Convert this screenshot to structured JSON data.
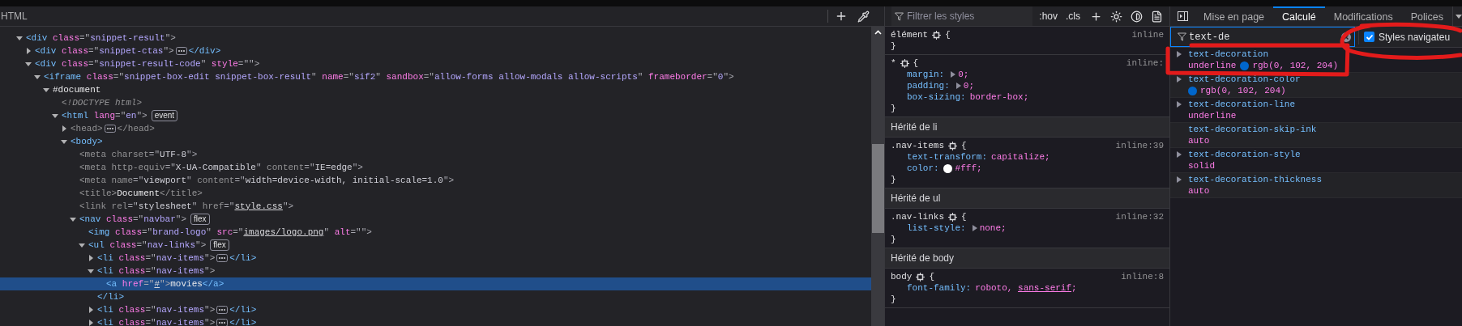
{
  "html_panel": {
    "title": "HTML",
    "tree": [
      {
        "expanded": true,
        "dimmed": false,
        "selected": false,
        "parts": [
          {
            "kind": "tag",
            "text": "<div"
          },
          {
            "kind": "attr",
            "text": " class"
          },
          {
            "kind": "punct",
            "text": "=\""
          },
          {
            "kind": "value",
            "text": "snippet-result"
          },
          {
            "kind": "punct",
            "text": "\">"
          }
        ],
        "children": [
          {
            "expanded": false,
            "dimmed": false,
            "selected": false,
            "parts": [
              {
                "kind": "tag",
                "text": "<div"
              },
              {
                "kind": "attr",
                "text": " class"
              },
              {
                "kind": "punct",
                "text": "=\""
              },
              {
                "kind": "value",
                "text": "snippet-ctas"
              },
              {
                "kind": "punct",
                "text": "\">"
              }
            ],
            "tail": [
              {
                "kind": "tag",
                "text": "</div>"
              }
            ]
          },
          {
            "expanded": true,
            "dimmed": false,
            "selected": false,
            "parts": [
              {
                "kind": "tag",
                "text": "<div"
              },
              {
                "kind": "attr",
                "text": " class"
              },
              {
                "kind": "punct",
                "text": "=\""
              },
              {
                "kind": "value",
                "text": "snippet-result-code"
              },
              {
                "kind": "punct",
                "text": "\""
              },
              {
                "kind": "attr",
                "text": " style"
              },
              {
                "kind": "punct",
                "text": "=\"\">"
              }
            ],
            "children": [
              {
                "expanded": true,
                "dimmed": false,
                "selected": false,
                "parts": [
                  {
                    "kind": "tag",
                    "text": "<iframe"
                  },
                  {
                    "kind": "attr",
                    "text": " class"
                  },
                  {
                    "kind": "punct",
                    "text": "=\""
                  },
                  {
                    "kind": "value",
                    "text": "snippet-box-edit snippet-box-result"
                  },
                  {
                    "kind": "punct",
                    "text": "\""
                  },
                  {
                    "kind": "attr",
                    "text": " name"
                  },
                  {
                    "kind": "punct",
                    "text": "=\""
                  },
                  {
                    "kind": "value",
                    "text": "sif2"
                  },
                  {
                    "kind": "punct",
                    "text": "\""
                  },
                  {
                    "kind": "attr",
                    "text": " sandbox"
                  },
                  {
                    "kind": "punct",
                    "text": "=\""
                  },
                  {
                    "kind": "value",
                    "text": "allow-forms allow-modals allow-scripts"
                  },
                  {
                    "kind": "punct",
                    "text": "\""
                  },
                  {
                    "kind": "attr",
                    "text": " frameborder"
                  },
                  {
                    "kind": "punct",
                    "text": "=\""
                  },
                  {
                    "kind": "value",
                    "text": "0"
                  },
                  {
                    "kind": "punct",
                    "text": "\">"
                  }
                ],
                "children": [
                  {
                    "expanded": true,
                    "dimmed": false,
                    "selected": false,
                    "parts": [
                      {
                        "kind": "text",
                        "text": "#document"
                      }
                    ],
                    "children": [
                      {
                        "dimmed": true,
                        "selected": false,
                        "parts": [
                          {
                            "kind": "doctype",
                            "text": "<!DOCTYPE html>"
                          }
                        ]
                      },
                      {
                        "expanded": true,
                        "dimmed": false,
                        "selected": false,
                        "parts": [
                          {
                            "kind": "tag",
                            "text": "<html"
                          },
                          {
                            "kind": "attr",
                            "text": " lang"
                          },
                          {
                            "kind": "punct",
                            "text": "=\""
                          },
                          {
                            "kind": "value",
                            "text": "en"
                          },
                          {
                            "kind": "punct",
                            "text": "\">"
                          }
                        ],
                        "badge": "event",
                        "children": [
                          {
                            "expanded": false,
                            "dimmed": true,
                            "selected": false,
                            "parts": [
                              {
                                "kind": "tag",
                                "text": "<head>"
                              }
                            ],
                            "tail": [
                              {
                                "kind": "tag",
                                "text": "</head>"
                              }
                            ]
                          },
                          {
                            "expanded": true,
                            "dimmed": false,
                            "selected": false,
                            "parts": [
                              {
                                "kind": "tag",
                                "text": "<body>"
                              }
                            ],
                            "children": [
                              {
                                "dimmed": true,
                                "selected": false,
                                "parts": [
                                  {
                                    "kind": "tag",
                                    "text": "<meta"
                                  },
                                  {
                                    "kind": "attr",
                                    "text": " charset"
                                  },
                                  {
                                    "kind": "punct",
                                    "text": "=\""
                                  },
                                  {
                                    "kind": "value",
                                    "text": "UTF-8"
                                  },
                                  {
                                    "kind": "punct",
                                    "text": "\">"
                                  }
                                ]
                              },
                              {
                                "dimmed": true,
                                "selected": false,
                                "parts": [
                                  {
                                    "kind": "tag",
                                    "text": "<meta"
                                  },
                                  {
                                    "kind": "attr",
                                    "text": " http-equiv"
                                  },
                                  {
                                    "kind": "punct",
                                    "text": "=\""
                                  },
                                  {
                                    "kind": "value",
                                    "text": "X-UA-Compatible"
                                  },
                                  {
                                    "kind": "punct",
                                    "text": "\""
                                  },
                                  {
                                    "kind": "attr",
                                    "text": " content"
                                  },
                                  {
                                    "kind": "punct",
                                    "text": "=\""
                                  },
                                  {
                                    "kind": "value",
                                    "text": "IE=edge"
                                  },
                                  {
                                    "kind": "punct",
                                    "text": "\">"
                                  }
                                ]
                              },
                              {
                                "dimmed": true,
                                "selected": false,
                                "parts": [
                                  {
                                    "kind": "tag",
                                    "text": "<meta"
                                  },
                                  {
                                    "kind": "attr",
                                    "text": " name"
                                  },
                                  {
                                    "kind": "punct",
                                    "text": "=\""
                                  },
                                  {
                                    "kind": "value",
                                    "text": "viewport"
                                  },
                                  {
                                    "kind": "punct",
                                    "text": "\""
                                  },
                                  {
                                    "kind": "attr",
                                    "text": " content"
                                  },
                                  {
                                    "kind": "punct",
                                    "text": "=\""
                                  },
                                  {
                                    "kind": "value",
                                    "text": "width=device-width, initial-scale=1.0"
                                  },
                                  {
                                    "kind": "punct",
                                    "text": "\">"
                                  }
                                ]
                              },
                              {
                                "dimmed": true,
                                "selected": false,
                                "parts": [
                                  {
                                    "kind": "tag",
                                    "text": "<title>"
                                  },
                                  {
                                    "kind": "text",
                                    "text": "Document"
                                  },
                                  {
                                    "kind": "tag",
                                    "text": "</title>"
                                  }
                                ]
                              },
                              {
                                "dimmed": true,
                                "selected": false,
                                "parts": [
                                  {
                                    "kind": "tag",
                                    "text": "<link"
                                  },
                                  {
                                    "kind": "attr",
                                    "text": " rel"
                                  },
                                  {
                                    "kind": "punct",
                                    "text": "=\""
                                  },
                                  {
                                    "kind": "value",
                                    "text": "stylesheet"
                                  },
                                  {
                                    "kind": "punct",
                                    "text": "\""
                                  },
                                  {
                                    "kind": "attr",
                                    "text": " href"
                                  },
                                  {
                                    "kind": "punct",
                                    "text": "=\""
                                  },
                                  {
                                    "kind": "link",
                                    "text": "style.css"
                                  },
                                  {
                                    "kind": "punct",
                                    "text": "\">"
                                  }
                                ]
                              },
                              {
                                "expanded": true,
                                "dimmed": false,
                                "selected": false,
                                "parts": [
                                  {
                                    "kind": "tag",
                                    "text": "<nav"
                                  },
                                  {
                                    "kind": "attr",
                                    "text": " class"
                                  },
                                  {
                                    "kind": "punct",
                                    "text": "=\""
                                  },
                                  {
                                    "kind": "value",
                                    "text": "navbar"
                                  },
                                  {
                                    "kind": "punct",
                                    "text": "\">"
                                  }
                                ],
                                "badge": "flex",
                                "children": [
                                  {
                                    "dimmed": false,
                                    "selected": false,
                                    "parts": [
                                      {
                                        "kind": "tag",
                                        "text": "<img"
                                      },
                                      {
                                        "kind": "attr",
                                        "text": " class"
                                      },
                                      {
                                        "kind": "punct",
                                        "text": "=\""
                                      },
                                      {
                                        "kind": "value",
                                        "text": "brand-logo"
                                      },
                                      {
                                        "kind": "punct",
                                        "text": "\""
                                      },
                                      {
                                        "kind": "attr",
                                        "text": " src"
                                      },
                                      {
                                        "kind": "punct",
                                        "text": "=\""
                                      },
                                      {
                                        "kind": "link",
                                        "text": "images/logo.png"
                                      },
                                      {
                                        "kind": "punct",
                                        "text": "\""
                                      },
                                      {
                                        "kind": "attr",
                                        "text": " alt"
                                      },
                                      {
                                        "kind": "punct",
                                        "text": "=\"\">"
                                      }
                                    ]
                                  },
                                  {
                                    "expanded": true,
                                    "dimmed": false,
                                    "selected": false,
                                    "parts": [
                                      {
                                        "kind": "tag",
                                        "text": "<ul"
                                      },
                                      {
                                        "kind": "attr",
                                        "text": " class"
                                      },
                                      {
                                        "kind": "punct",
                                        "text": "=\""
                                      },
                                      {
                                        "kind": "value",
                                        "text": "nav-links"
                                      },
                                      {
                                        "kind": "punct",
                                        "text": "\">"
                                      }
                                    ],
                                    "badge": "flex",
                                    "children": [
                                      {
                                        "expanded": false,
                                        "dimmed": false,
                                        "selected": false,
                                        "parts": [
                                          {
                                            "kind": "tag",
                                            "text": "<li"
                                          },
                                          {
                                            "kind": "attr",
                                            "text": " class"
                                          },
                                          {
                                            "kind": "punct",
                                            "text": "=\""
                                          },
                                          {
                                            "kind": "value",
                                            "text": "nav-items"
                                          },
                                          {
                                            "kind": "punct",
                                            "text": "\">"
                                          }
                                        ],
                                        "tail": [
                                          {
                                            "kind": "tag",
                                            "text": "</li>"
                                          }
                                        ]
                                      },
                                      {
                                        "expanded": true,
                                        "dimmed": false,
                                        "selected": false,
                                        "parts": [
                                          {
                                            "kind": "tag",
                                            "text": "<li"
                                          },
                                          {
                                            "kind": "attr",
                                            "text": " class"
                                          },
                                          {
                                            "kind": "punct",
                                            "text": "=\""
                                          },
                                          {
                                            "kind": "value",
                                            "text": "nav-items"
                                          },
                                          {
                                            "kind": "punct",
                                            "text": "\">"
                                          }
                                        ],
                                        "close": [
                                          {
                                            "kind": "tag",
                                            "text": "</li>"
                                          }
                                        ],
                                        "children": [
                                          {
                                            "dimmed": false,
                                            "selected": true,
                                            "parts": [
                                              {
                                                "kind": "tag",
                                                "text": "<a"
                                              },
                                              {
                                                "kind": "attr",
                                                "text": " href"
                                              },
                                              {
                                                "kind": "punct",
                                                "text": "=\""
                                              },
                                              {
                                                "kind": "link",
                                                "text": "#"
                                              },
                                              {
                                                "kind": "punct",
                                                "text": "\">"
                                              },
                                              {
                                                "kind": "text",
                                                "text": "movies"
                                              },
                                              {
                                                "kind": "tag",
                                                "text": "</a>"
                                              }
                                            ]
                                          }
                                        ]
                                      },
                                      {
                                        "expanded": false,
                                        "dimmed": false,
                                        "selected": false,
                                        "parts": [
                                          {
                                            "kind": "tag",
                                            "text": "<li"
                                          },
                                          {
                                            "kind": "attr",
                                            "text": " class"
                                          },
                                          {
                                            "kind": "punct",
                                            "text": "=\""
                                          },
                                          {
                                            "kind": "value",
                                            "text": "nav-items"
                                          },
                                          {
                                            "kind": "punct",
                                            "text": "\">"
                                          }
                                        ],
                                        "tail": [
                                          {
                                            "kind": "tag",
                                            "text": "</li>"
                                          }
                                        ]
                                      },
                                      {
                                        "expanded": false,
                                        "dimmed": false,
                                        "selected": false,
                                        "parts": [
                                          {
                                            "kind": "tag",
                                            "text": "<li"
                                          },
                                          {
                                            "kind": "attr",
                                            "text": " class"
                                          },
                                          {
                                            "kind": "punct",
                                            "text": "=\""
                                          },
                                          {
                                            "kind": "value",
                                            "text": "nav-items"
                                          },
                                          {
                                            "kind": "punct",
                                            "text": "\">"
                                          }
                                        ],
                                        "tail": [
                                          {
                                            "kind": "tag",
                                            "text": "</li>"
                                          }
                                        ]
                                      }
                                    ]
                                  }
                                ]
                              }
                            ]
                          }
                        ]
                      }
                    ]
                  }
                ]
              }
            ]
          }
        ]
      }
    ]
  },
  "rules_panel": {
    "filter": {
      "placeholder": "Filtrer les styles"
    },
    "buttons": [
      ":hov",
      ".cls"
    ],
    "blocks": [
      {
        "kind": "rule",
        "selector": "élément",
        "open": "{",
        "close": "}",
        "source": "inline"
      },
      {
        "kind": "rule",
        "selector": "*",
        "open": "{",
        "close": "}",
        "source": "inline:",
        "declarations": [
          {
            "prop": "margin:",
            "value": "0;",
            "expandable": true
          },
          {
            "prop": "padding:",
            "value": "0;",
            "expandable": true
          },
          {
            "prop": "box-sizing:",
            "value": "border-box;",
            "expandable": false
          }
        ]
      },
      {
        "kind": "header",
        "text": "Hérité de li"
      },
      {
        "kind": "rule",
        "selector": ".nav-items",
        "open": "{",
        "close": "}",
        "source": "inline:39",
        "declarations": [
          {
            "prop": "text-transform:",
            "value": "capitalize;",
            "expandable": false
          },
          {
            "prop": "color:",
            "value": "#fff;",
            "expandable": false,
            "color": "#ffffff"
          }
        ]
      },
      {
        "kind": "header",
        "text": "Hérité de ul"
      },
      {
        "kind": "rule",
        "selector": ".nav-links",
        "open": "{",
        "close": "}",
        "source": "inline:32",
        "declarations": [
          {
            "prop": "list-style:",
            "value": "none;",
            "expandable": true
          }
        ]
      },
      {
        "kind": "header",
        "text": "Hérité de body"
      },
      {
        "kind": "rule",
        "selector": "body",
        "open": "{",
        "close": "}",
        "source": "inline:8",
        "declarations": [
          {
            "prop": "font-family:",
            "value": "roboto, ",
            "value_link": "sans-serif",
            "value_end": ";",
            "expandable": false
          }
        ]
      }
    ]
  },
  "computed_panel": {
    "tabs": [
      {
        "label": "Mise en page",
        "selected": false
      },
      {
        "label": "Calculé",
        "selected": true
      },
      {
        "label": "Modifications",
        "selected": false
      },
      {
        "label": "Polices",
        "selected": false
      }
    ],
    "filter": {
      "value": "text-de"
    },
    "browser_styles": {
      "label": "Styles navigateu",
      "checked": true
    },
    "properties": [
      {
        "name": "text-decoration",
        "value": "underline",
        "color": "#0066cc",
        "swatch_value": "rgb(0, 102, 204)",
        "expandable": true
      },
      {
        "name": "text-decoration-color",
        "color": "#0066cc",
        "swatch_value": "rgb(0, 102, 204)",
        "expandable": true
      },
      {
        "name": "text-decoration-line",
        "value": "underline",
        "expandable": true
      },
      {
        "name": "text-decoration-skip-ink",
        "value": "auto",
        "expandable": false
      },
      {
        "name": "text-decoration-style",
        "value": "solid",
        "expandable": true
      },
      {
        "name": "text-decoration-thickness",
        "value": "auto",
        "expandable": true
      }
    ]
  }
}
